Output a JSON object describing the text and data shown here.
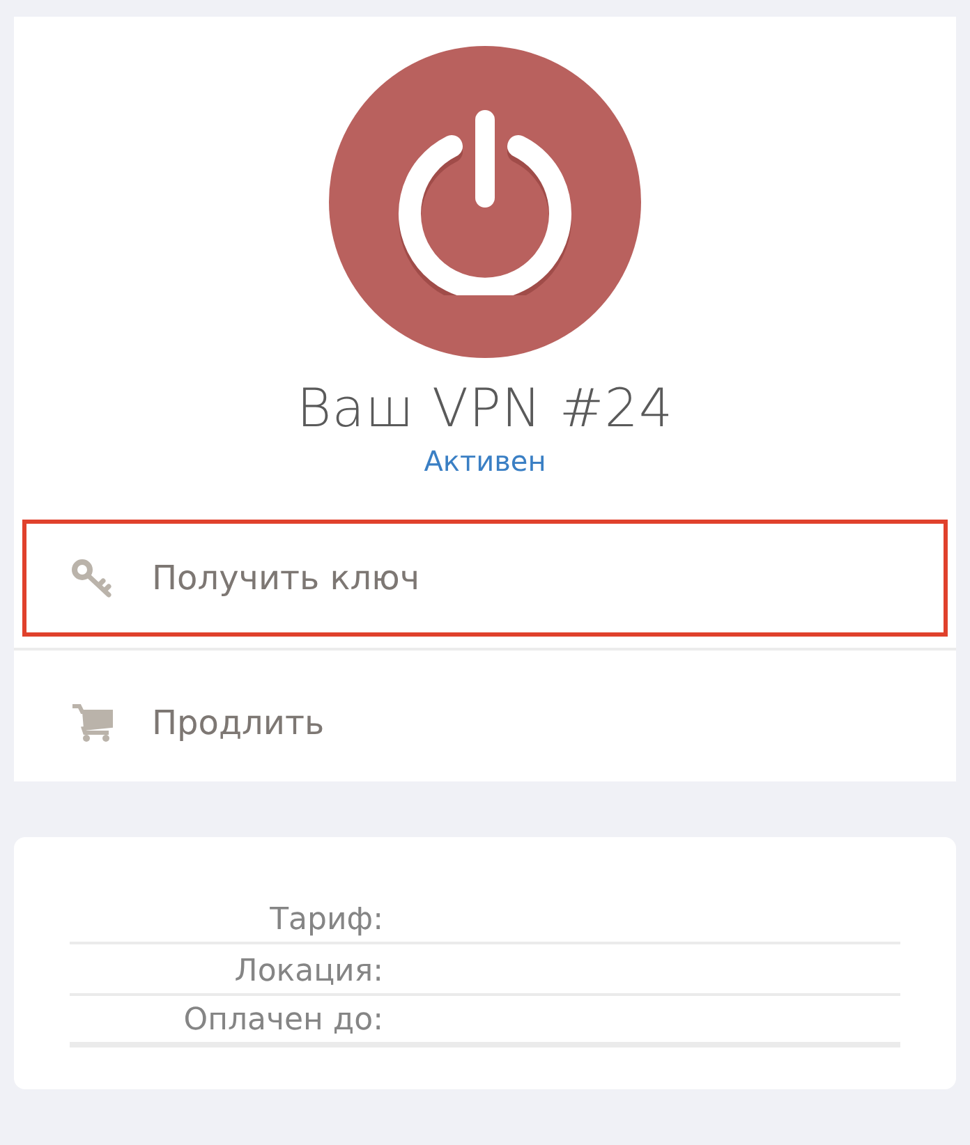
{
  "vpn": {
    "power_on": false,
    "title": "Ваш VPN #24",
    "status": "Активен"
  },
  "actions": [
    {
      "kind": "key",
      "label": "Получить ключ",
      "highlighted": true
    },
    {
      "kind": "cart",
      "label": "Продлить",
      "highlighted": false
    }
  ],
  "details": [
    {
      "label": "Тариф:"
    },
    {
      "label": "Локация:"
    },
    {
      "label": "Оплачен до:"
    }
  ]
}
